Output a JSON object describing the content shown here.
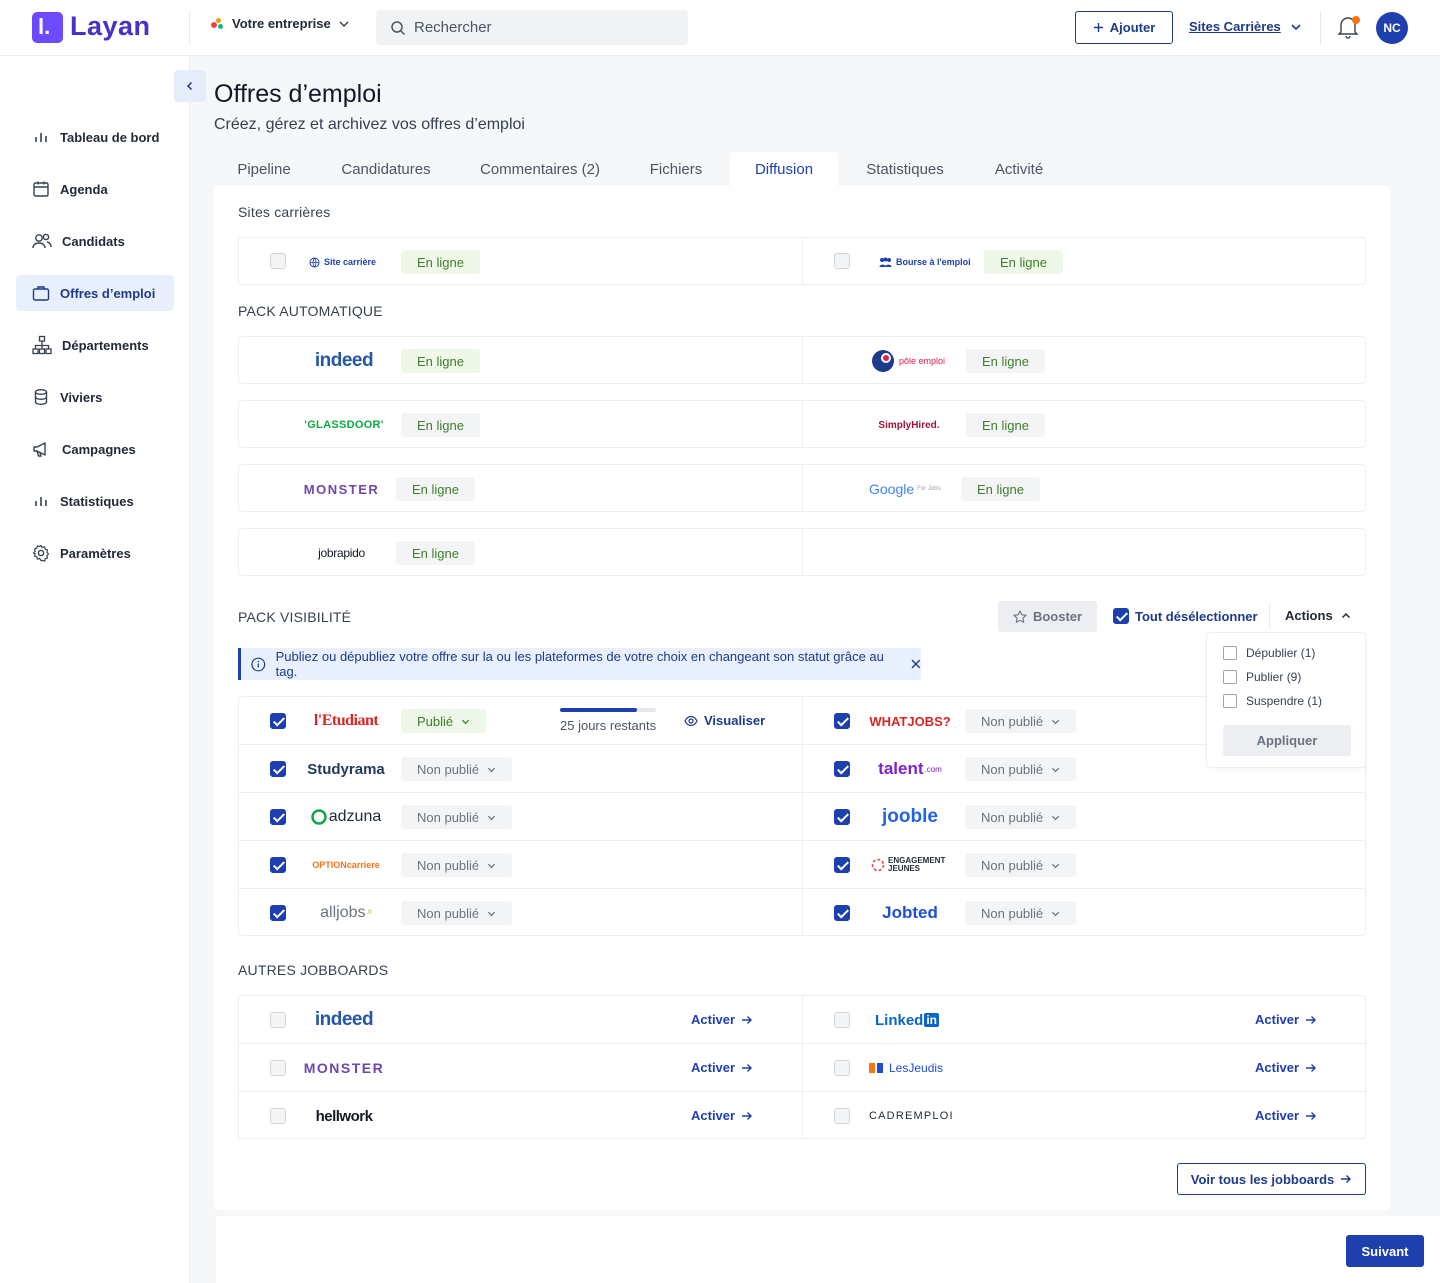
{
  "app": {
    "name": "Layan",
    "logo_letter": "l."
  },
  "header": {
    "company": "Votre entreprise",
    "search_placeholder": "Rechercher",
    "add_label": "Ajouter",
    "sites_label": "Sites Carrières",
    "avatar_initials": "NC"
  },
  "sidebar": {
    "items": [
      {
        "label": "Tableau de bord",
        "icon": "bar-chart-icon"
      },
      {
        "label": "Agenda",
        "icon": "calendar-icon"
      },
      {
        "label": "Candidats",
        "icon": "users-icon"
      },
      {
        "label": "Offres d’emploi",
        "icon": "briefcase-icon",
        "active": true
      },
      {
        "label": "Départements",
        "icon": "org-chart-icon"
      },
      {
        "label": "Viviers",
        "icon": "database-icon"
      },
      {
        "label": "Campagnes",
        "icon": "megaphone-icon"
      },
      {
        "label": "Statistiques",
        "icon": "bar-chart-icon"
      },
      {
        "label": "Paramètres",
        "icon": "gear-icon"
      }
    ]
  },
  "page": {
    "title": "Offres d’emploi",
    "subtitle": "Créez, gérez et archivez vos offres d’emploi",
    "tabs": [
      "Pipeline",
      "Candidatures",
      "Commentaires (2)",
      "Fichiers",
      "Diffusion",
      "Statistiques",
      "Activité"
    ],
    "active_tab": "Diffusion"
  },
  "sites_carrieres": {
    "label": "Sites carrières",
    "left": {
      "name": "Site carrière",
      "status": "En ligne"
    },
    "right": {
      "name": "Bourse à l'emploi",
      "status": "En ligne"
    }
  },
  "pack_auto": {
    "label": "PACK AUTOMATIQUE",
    "status": "En ligne",
    "left": [
      "indeed",
      "'GLASSDOOR'",
      "MONSTER",
      "jobrapido"
    ],
    "right": [
      "pôle emploi",
      "SimplyHired.",
      "Google"
    ],
    "google_suffix": "For Jobs"
  },
  "pack_vis": {
    "label": "PACK VISIBILITÉ",
    "booster": "Booster",
    "deselect": "Tout désélectionner",
    "actions": "Actions",
    "menu": [
      "Dépublier (1)",
      "Publier (9)",
      "Suspendre (1)"
    ],
    "apply": "Appliquer",
    "info": "Publiez ou dépubliez votre offre sur la ou les plateformes de votre choix en changeant son statut grâce au tag.",
    "published": "Publié",
    "unpublished": "Non publié",
    "progress_fraction": 0.8,
    "days_left": "25 jours restants",
    "visualize": "Visualiser",
    "left": [
      "l'Etudiant",
      "Studyrama",
      "adzuna",
      "OPTIONcarriere",
      "alljobs"
    ],
    "right": [
      "WHATJOBS?",
      "talent",
      "jooble",
      "ENGAGEMENT JEUNES",
      "Jobted"
    ],
    "talent_suffix": ".com",
    "alljobs_suffix": ".fr"
  },
  "autres": {
    "label": "AUTRES JOBBOARDS",
    "activate": "Activer",
    "left": [
      "indeed",
      "MONSTER",
      "hellwork"
    ],
    "right": [
      "Linked",
      "LesJeudis",
      "CADREMPLOI"
    ],
    "linkedin_in": "in"
  },
  "see_all": "Voir tous les jobboards",
  "next": "Suivant",
  "colors": {
    "primary": "#1e40af",
    "brand": "#6d4aff",
    "online_bg": "#eef7e8",
    "online_text": "#3f7d2b"
  }
}
